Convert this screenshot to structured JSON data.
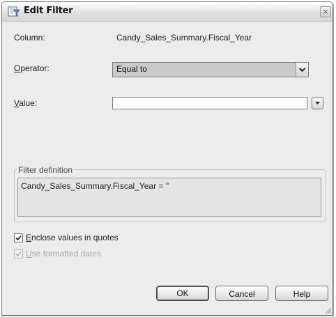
{
  "window": {
    "title": "Edit Filter",
    "close_glyph": "×"
  },
  "column": {
    "label": "Column:",
    "value": "Candy_Sales_Summary.Fiscal_Year"
  },
  "operator": {
    "label_mnemonic": "O",
    "label_rest": "perator:",
    "selected": "Equal to"
  },
  "value_field": {
    "label_mnemonic": "V",
    "label_rest": "alue:",
    "value": ""
  },
  "filter_definition": {
    "legend": "Filter definition",
    "text": "Candy_Sales_Summary.Fiscal_Year = ''"
  },
  "options": {
    "enclose_quotes": {
      "mnemonic": "E",
      "rest": "nclose values in quotes",
      "checked": true
    },
    "formatted_dates": {
      "mnemonic": "U",
      "rest": "se formatted dates",
      "checked": true,
      "disabled": true
    }
  },
  "buttons": {
    "ok": "OK",
    "cancel": "Cancel",
    "help": "Help"
  },
  "icons": {
    "title": "filter-edit-icon",
    "close": "close-icon",
    "dropdown": "chevron-down-icon",
    "check": "checkmark-icon",
    "grip": "resize-grip-icon"
  },
  "colors": {
    "dialog_bg": "#ececec",
    "select_bg": "#c9c9c9",
    "definition_bg": "#e4e4e4",
    "disabled_text": "#a8a8a8"
  }
}
